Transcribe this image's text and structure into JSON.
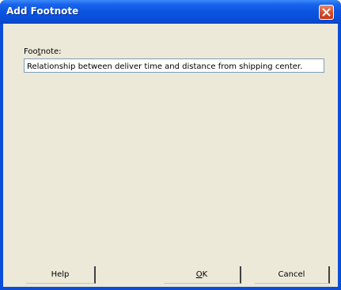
{
  "window": {
    "title": "Add Footnote"
  },
  "footnote": {
    "label_prefix": "Foo",
    "label_accel": "t",
    "label_suffix": "note:",
    "value": "Relationship between deliver time and distance from shipping center."
  },
  "buttons": {
    "help": "Help",
    "ok_accel": "O",
    "ok_rest": "K",
    "cancel": "Cancel"
  },
  "icons": {
    "close": "close-icon"
  },
  "colors": {
    "titlebar": "#0a4dd8",
    "dialog_bg": "#ece9d8",
    "close_button": "#d6502a"
  }
}
